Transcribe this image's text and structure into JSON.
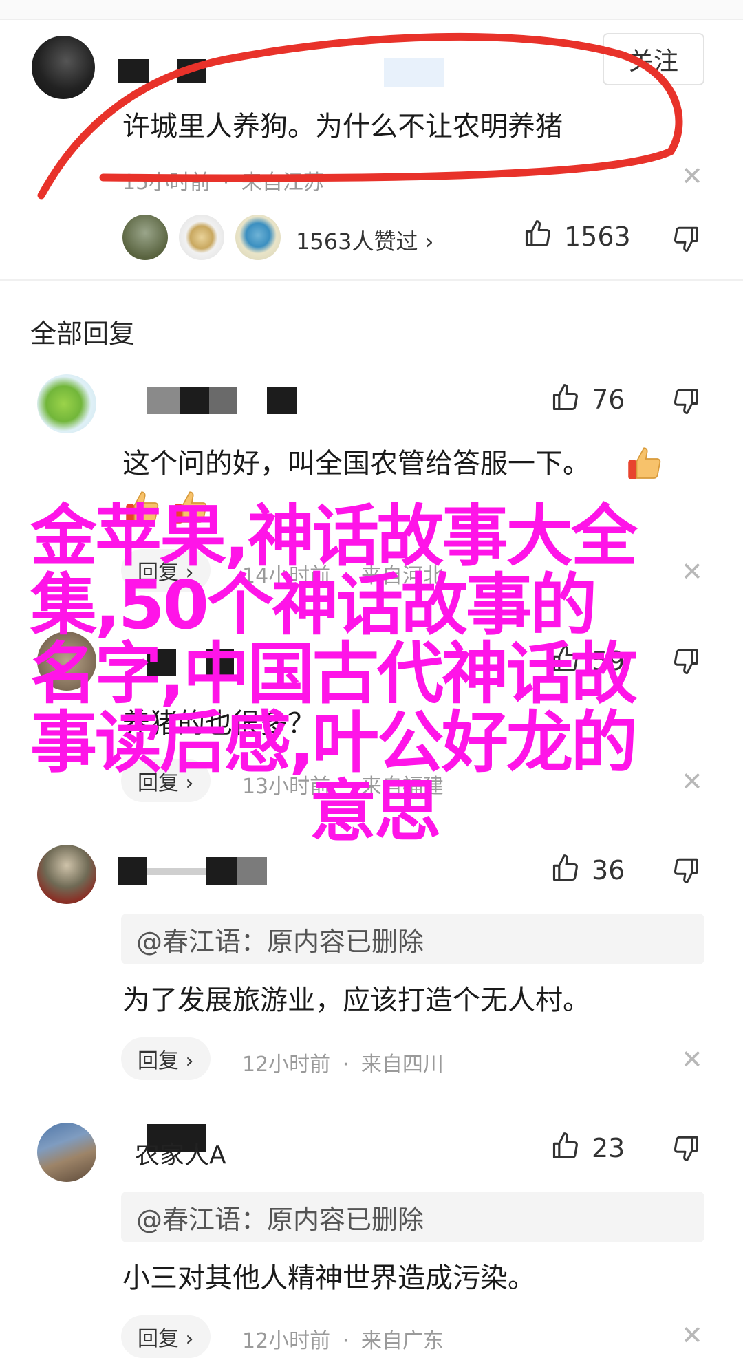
{
  "colors": {
    "overlay": "#ff14e8",
    "annotation": "#e8322a",
    "muted": "#9a9a9a"
  },
  "main_comment": {
    "follow_label": "关注",
    "text": "许城里人养狗。为什么不让农明养猪",
    "time": "15小时前",
    "sep": "·",
    "location": "来自江苏",
    "likes_link": "1563人赞过 ›",
    "like_count": "1563"
  },
  "section_title": "全部回复",
  "replies": [
    {
      "like_count": "76",
      "text": "这个问的好，叫全国农管给答服一下。",
      "reply_label": "回复 ›",
      "time": "14小时前",
      "location": "来自河北"
    },
    {
      "name": "…",
      "like_count": "59",
      "text": "养猪的也很多？",
      "reply_label": "回复 ›",
      "time": "13小时前",
      "location": "来自福建"
    },
    {
      "like_count": "36",
      "quote": "@春江语：原内容已删除",
      "text": "为了发展旅游业，应该打造个无人村。",
      "reply_label": "回复 ›",
      "time": "12小时前",
      "location": "来自四川"
    },
    {
      "name": "农家人A",
      "like_count": "23",
      "quote": "@春江语：原内容已删除",
      "text": "小三对其他人精神世界造成污染。",
      "reply_label": "回复 ›",
      "time": "12小时前",
      "location": "来自广东"
    }
  ],
  "overlay": {
    "line1": "金苹果,神话故事大全",
    "line2": "集,50个神话故事的",
    "line3": "名字,中国古代神话故",
    "line4": "事读后感,叶公好龙的",
    "line5": "意思"
  },
  "icons": [
    "thumbs-up-icon",
    "thumbs-down-icon",
    "close-icon",
    "chevron-right-icon",
    "thumbs-up-emoji-icon"
  ]
}
